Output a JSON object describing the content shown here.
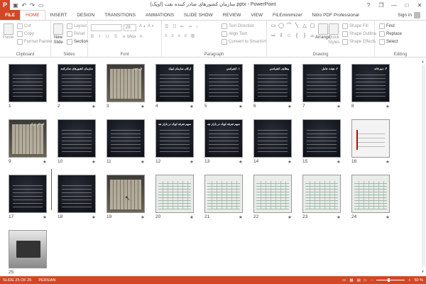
{
  "app": {
    "logo": "P",
    "title": "سازمان کشورهای صادر کننده نفت (اوپک).pptx - PowerPoint"
  },
  "qat": [
    "save-icon",
    "undo-icon",
    "redo-icon",
    "present-icon"
  ],
  "window": {
    "help": "?",
    "restore": "❐",
    "minimize": "—",
    "maximize": "□",
    "close": "✕"
  },
  "tabs": [
    "FILE",
    "HOME",
    "INSERT",
    "DESIGN",
    "TRANSITIONS",
    "ANIMATIONS",
    "SLIDE SHOW",
    "REVIEW",
    "VIEW",
    "FILEminimizer",
    "Nitro PDF Professional"
  ],
  "active_tab": "HOME",
  "signin": "Sign in",
  "ribbon": {
    "clipboard": {
      "paste": "Paste",
      "cut": "Cut",
      "copy": "Copy",
      "format_painter": "Format Painter",
      "label": "Clipboard"
    },
    "slides": {
      "new_slide_1": "New",
      "new_slide_2": "Slide",
      "layout": "Layout",
      "reset": "Reset",
      "section": "Section",
      "label": "Slides"
    },
    "font": {
      "size": "28",
      "label": "Font"
    },
    "paragraph": {
      "text_direction": "Text Direction",
      "align_text": "Align Text",
      "convert": "Convert to SmartArt",
      "label": "Paragraph"
    },
    "drawing": {
      "arrange": "Arrange",
      "quick_styles_1": "Quick",
      "quick_styles_2": "Styles",
      "shape_fill": "Shape Fill",
      "shape_outline": "Shape Outline",
      "shape_effects": "Shape Effects",
      "label": "Drawing"
    },
    "editing": {
      "find": "Find",
      "replace": "Replace",
      "select": "Select",
      "label": "Editing"
    }
  },
  "slides": [
    {
      "n": "1",
      "star": "",
      "title": ""
    },
    {
      "n": "2",
      "star": "★",
      "title": "سازمان کشورهای صادرکننده نفت"
    },
    {
      "n": "3",
      "star": "★",
      "title": "تاریخچه"
    },
    {
      "n": "4",
      "star": "★",
      "title": "ارکان سازمان اوپک"
    },
    {
      "n": "5",
      "star": "★",
      "title": "۱- کنفرانس"
    },
    {
      "n": "6",
      "star": "★",
      "title": "وظایف کنفرانس"
    },
    {
      "n": "7",
      "star": "★",
      "title": "۲- هیئت عامل"
    },
    {
      "n": "8",
      "star": "★",
      "title": "۳- دبیرخانه"
    },
    {
      "n": "9",
      "star": "★",
      "title": "اهداف اوپک"
    },
    {
      "n": "10",
      "star": "★",
      "title": ""
    },
    {
      "n": "11",
      "star": "★",
      "title": ""
    },
    {
      "n": "12",
      "star": "★",
      "title": "سهم تعرفه اوپک در بازار نفت"
    },
    {
      "n": "13",
      "star": "★",
      "title": "سهم تعرفه اوپک در بازار نفت"
    },
    {
      "n": "14",
      "star": "★",
      "title": ""
    },
    {
      "n": "15",
      "star": "★",
      "title": ""
    },
    {
      "n": "16",
      "star": "★",
      "title": ""
    },
    {
      "n": "17",
      "star": "★",
      "title": ""
    },
    {
      "n": "18",
      "star": "★",
      "title": ""
    },
    {
      "n": "19",
      "star": "★",
      "title": ""
    },
    {
      "n": "20",
      "star": "★",
      "title": ""
    },
    {
      "n": "21",
      "star": "★",
      "title": ""
    },
    {
      "n": "22",
      "star": "★",
      "title": ""
    },
    {
      "n": "23",
      "star": "★",
      "title": ""
    },
    {
      "n": "24",
      "star": "★",
      "title": ""
    },
    {
      "n": "25",
      "star": "",
      "title": ""
    }
  ],
  "status": {
    "slide": "SLIDE 25 OF 25",
    "lang": "PERSIAN",
    "zoom": "50 %"
  },
  "colors": {
    "accent": "#d24726"
  }
}
